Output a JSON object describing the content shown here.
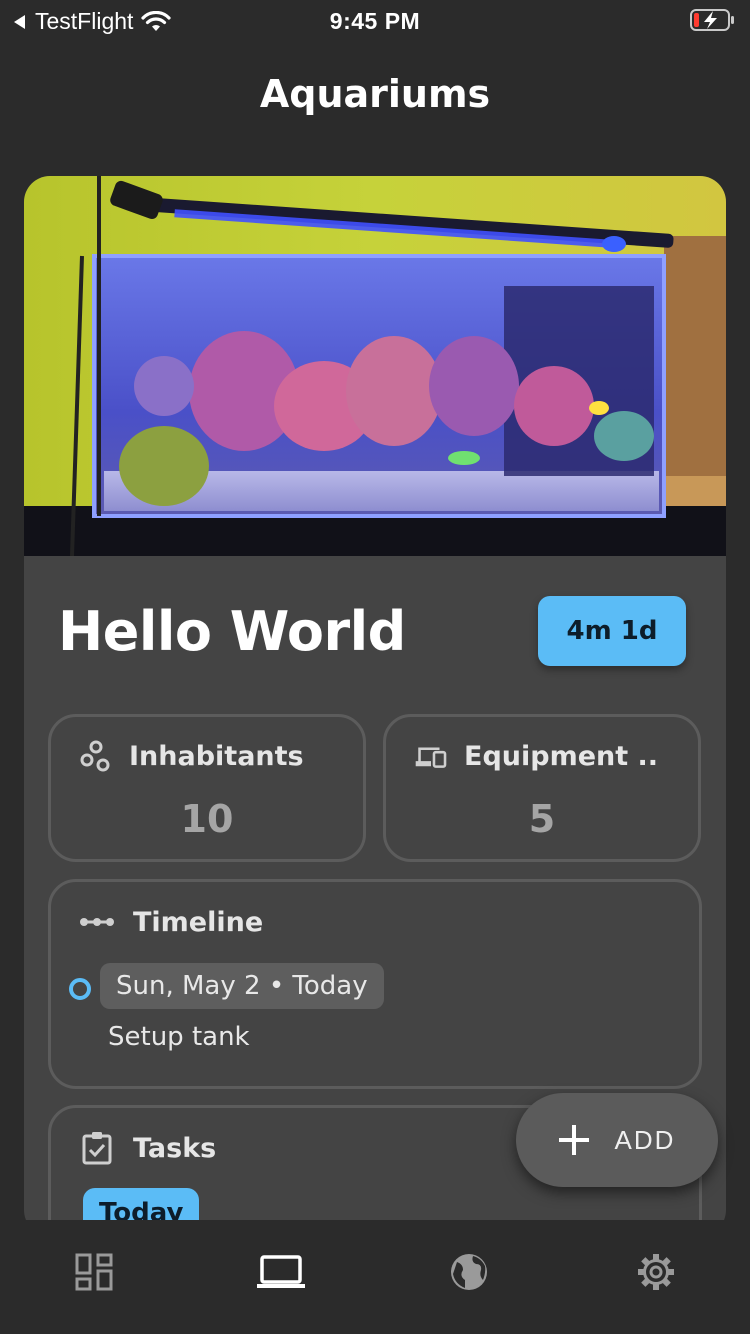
{
  "status_bar": {
    "back_app": "TestFlight",
    "time": "9:45 PM"
  },
  "page": {
    "title": "Aquariums"
  },
  "aquarium": {
    "name": "Hello World",
    "age_badge": "4m 1d",
    "inhabitants": {
      "label": "Inhabitants",
      "value": "10",
      "icon": "inhabitants-icon"
    },
    "equipment": {
      "label": "Equipment ..",
      "value": "5",
      "icon": "devices-icon"
    },
    "timeline": {
      "label": "Timeline",
      "entries": [
        {
          "date": "Sun, May 2 • Today",
          "event": "Setup tank"
        }
      ]
    },
    "tasks": {
      "label": "Tasks",
      "group_badge": "Today"
    }
  },
  "fab": {
    "label": "ADD"
  },
  "bottom_nav": {
    "items": [
      {
        "icon": "dashboard-icon",
        "selected": false
      },
      {
        "icon": "laptop-icon",
        "selected": true
      },
      {
        "icon": "globe-icon",
        "selected": false
      },
      {
        "icon": "gear-icon",
        "selected": false
      }
    ]
  },
  "colors": {
    "background": "#2b2b2b",
    "card": "#444444",
    "accent": "#5bbcf6",
    "border": "#5c5c5c",
    "muted_text": "#a5a5a5"
  }
}
